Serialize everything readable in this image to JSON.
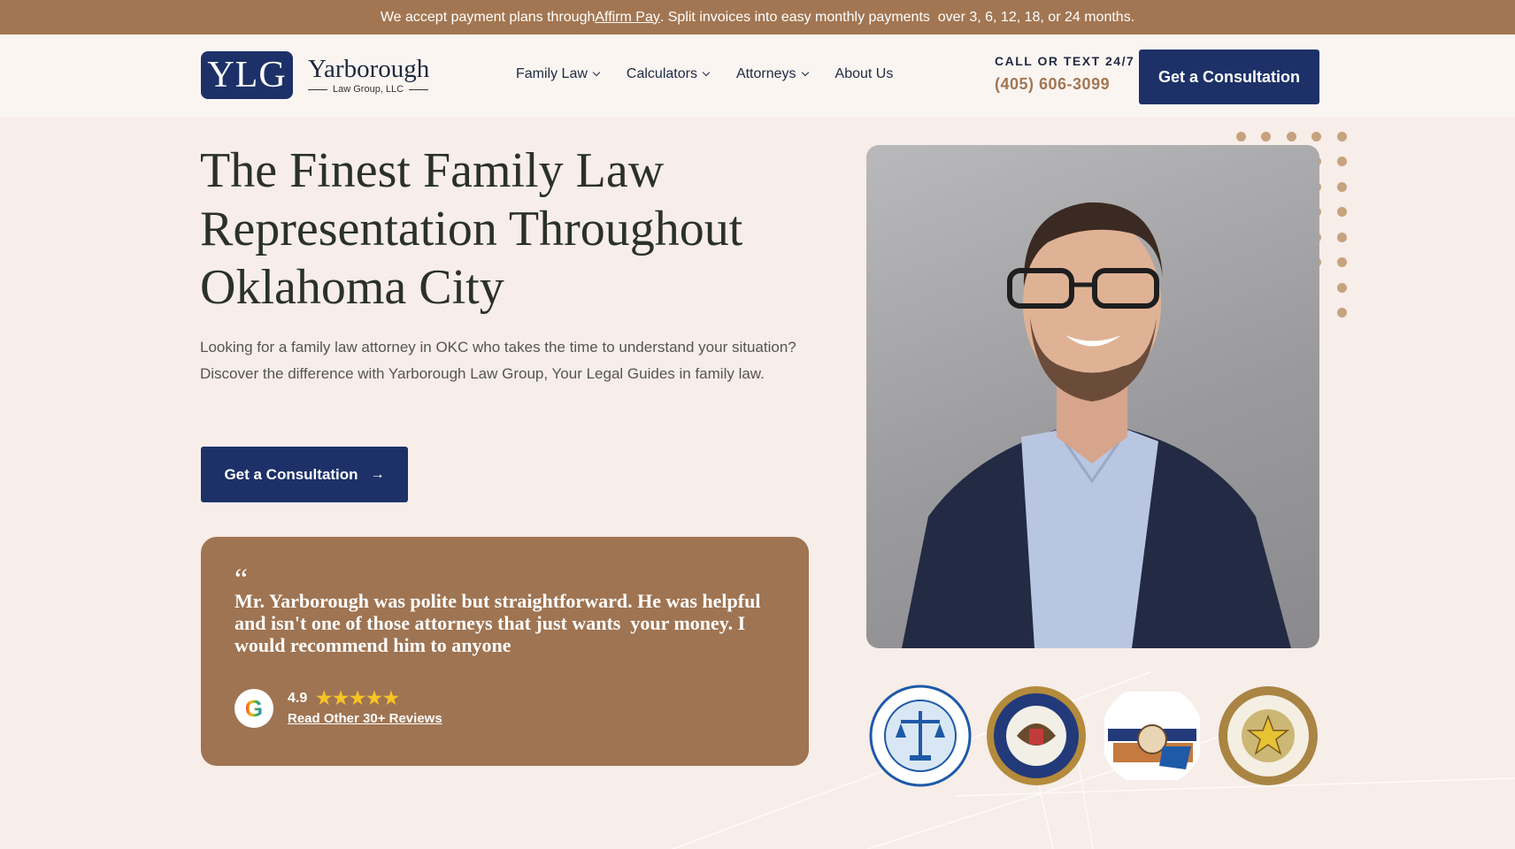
{
  "promo": {
    "text_before": "We accept payment plans through ",
    "link_text": "Affirm Pay",
    "text_after": ". Split invoices into easy monthly payments  over 3, 6, 12, 18, or 24 months."
  },
  "logo": {
    "mark": "YLG",
    "name": "Yarborough",
    "sub": "Law Group, LLC"
  },
  "nav": {
    "items": [
      {
        "label": "Family Law",
        "dropdown": true
      },
      {
        "label": "Calculators",
        "dropdown": true
      },
      {
        "label": "Attorneys",
        "dropdown": true
      },
      {
        "label": "About Us",
        "dropdown": false
      }
    ]
  },
  "contact": {
    "label": "CALL OR TEXT 24/7",
    "phone": "(405) 606-3099"
  },
  "header_cta": "Get a Consultation",
  "hero": {
    "title": "The Finest Family Law Representation Throughout Oklahoma City",
    "description": "Looking for a family law attorney in OKC who takes the time to understand your situation? Discover the difference with Yarborough Law Group, Your Legal Guides in family law.",
    "cta": "Get a Consultation"
  },
  "review": {
    "quote_mark": "“",
    "text": "Mr. Yarborough was polite but straightforward. He was helpful and isn't one of those attorneys that just wants  your money. I would recommend him to anyone",
    "rating": "4.9",
    "stars": "★★★★★",
    "link": "Read Other 30+ Reviews",
    "google_letter": "G"
  },
  "colors": {
    "brand_navy": "#1d3168",
    "brand_brown": "#a27652",
    "page_bg": "#f7ede9",
    "star": "#f7c325"
  },
  "badges": [
    "oklahoma-bar-association-seal",
    "us-district-court-seal",
    "cheyenne-arapaho-tribes-seal",
    "cherokee-nation-seal"
  ]
}
